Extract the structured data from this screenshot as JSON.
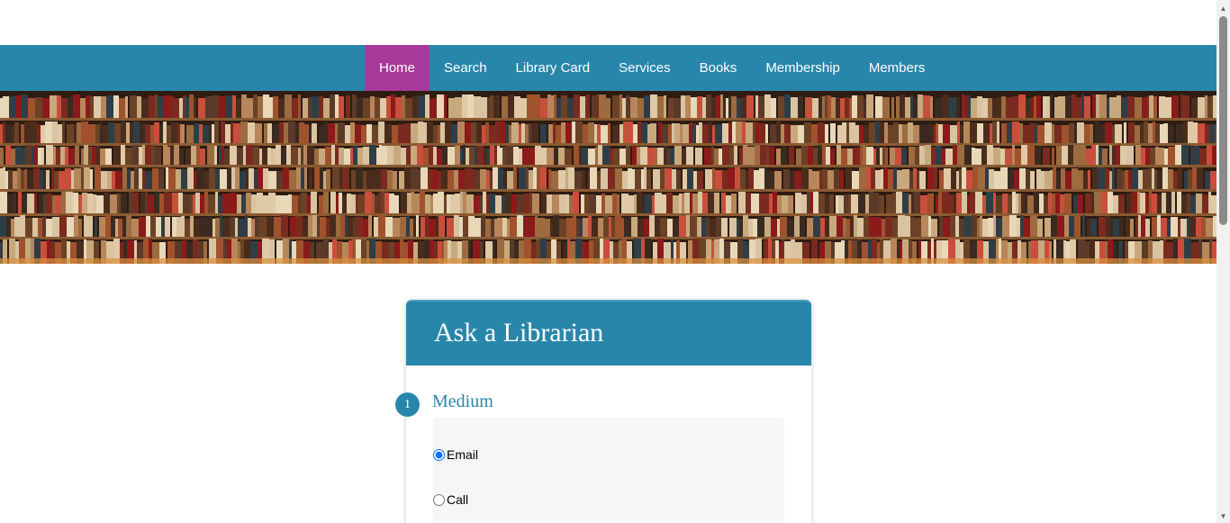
{
  "nav": {
    "items": [
      {
        "label": "Home",
        "active": true
      },
      {
        "label": "Search",
        "active": false
      },
      {
        "label": "Library Card",
        "active": false
      },
      {
        "label": "Services",
        "active": false
      },
      {
        "label": "Books",
        "active": false
      },
      {
        "label": "Membership",
        "active": false
      },
      {
        "label": "Members",
        "active": false
      }
    ]
  },
  "hero": {
    "image": "library-bookshelves"
  },
  "card": {
    "title": "Ask a Librarian",
    "step": {
      "number": "1",
      "title": "Medium"
    },
    "options": [
      {
        "label": "Email",
        "checked": true
      },
      {
        "label": "Call",
        "checked": false
      }
    ]
  },
  "colors": {
    "primary": "#2986ab",
    "active_nav": "#a7399b",
    "options_bg": "#f6f6f6"
  }
}
